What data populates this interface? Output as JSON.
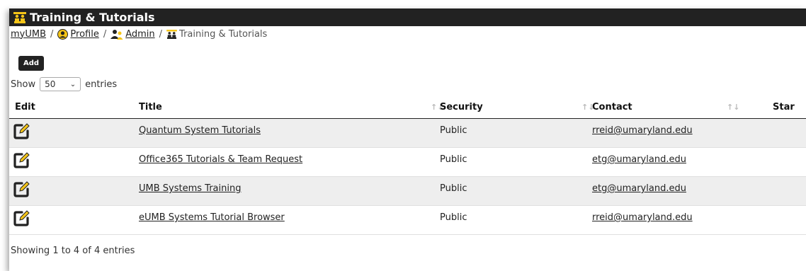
{
  "header": {
    "title": "Training & Tutorials",
    "title_icon": "people-training-icon"
  },
  "breadcrumb": {
    "items": [
      {
        "label": "myUMB",
        "link": true
      },
      {
        "label": "Profile",
        "link": true,
        "icon": "user-circle-icon"
      },
      {
        "label": "Admin",
        "link": true,
        "icon": "admin-users-icon"
      },
      {
        "label": "Training & Tutorials",
        "link": false,
        "icon": "people-training-icon"
      }
    ],
    "separator": "/"
  },
  "toolbar": {
    "add_label": "Add"
  },
  "length_menu": {
    "prefix": "Show",
    "value": "50",
    "suffix": "entries"
  },
  "table": {
    "columns": [
      "Edit",
      "Title",
      "Security",
      "Contact",
      "Star"
    ],
    "rows": [
      {
        "title": "Quantum System Tutorials",
        "security": "Public",
        "contact": "rreid@umaryland.edu"
      },
      {
        "title": "Office365 Tutorials & Team Request",
        "security": "Public",
        "contact": "etg@umaryland.edu"
      },
      {
        "title": "UMB Systems Training",
        "security": "Public",
        "contact": "etg@umaryland.edu"
      },
      {
        "title": "eUMB Systems Tutorial Browser",
        "security": "Public",
        "contact": "rreid@umaryland.edu"
      }
    ]
  },
  "info": {
    "text": "Showing 1 to 4 of 4 entries"
  },
  "colors": {
    "header_bg": "#222222",
    "accent_yellow": "#f5c518",
    "row_stripe": "#eeeeee"
  }
}
